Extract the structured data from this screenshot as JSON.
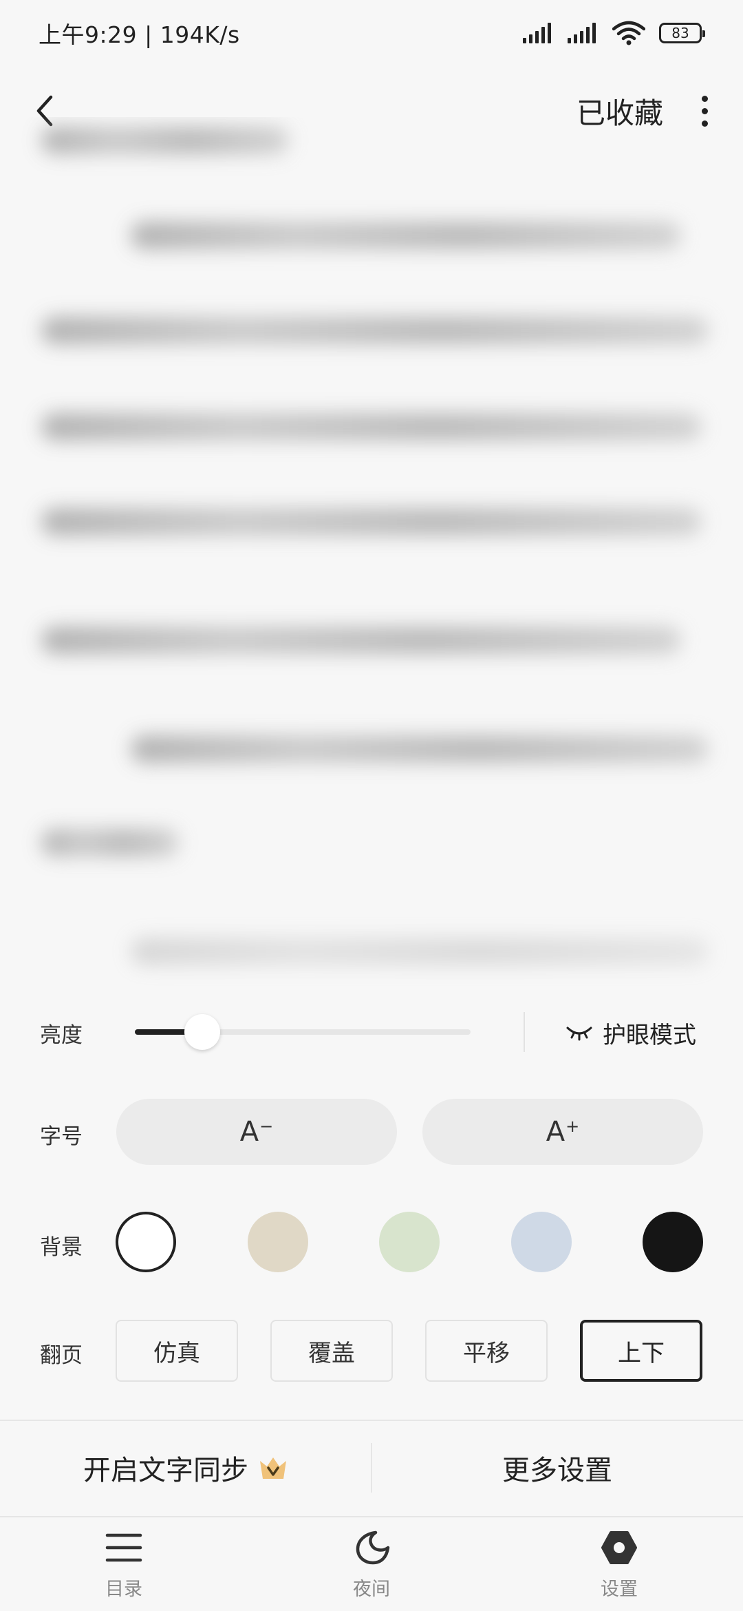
{
  "status": {
    "time_speed": "上午9:29 | 194K/s",
    "battery": "83"
  },
  "header": {
    "fav_label": "已收藏"
  },
  "settings": {
    "brightness_label": "亮度",
    "brightness_level": 0.2,
    "eye_mode_label": "护眼模式",
    "font_label": "字号",
    "font_decrease": "A",
    "font_decrease_mark": "−",
    "font_increase": "A",
    "font_increase_mark": "+",
    "background_label": "背景",
    "backgrounds": [
      "#ffffff",
      "#e0d8c6",
      "#d8e4cd",
      "#cfd9e6",
      "#151515"
    ],
    "selected_background": 0,
    "page_turn_label": "翻页",
    "page_turn_options": [
      "仿真",
      "覆盖",
      "平移",
      "上下"
    ],
    "selected_page_turn": 3
  },
  "actions": {
    "sync_label": "开启文字同步",
    "more_label": "更多设置"
  },
  "bottom_nav": {
    "items": [
      {
        "label": "目录",
        "icon": "list-icon"
      },
      {
        "label": "夜间",
        "icon": "moon-icon"
      },
      {
        "label": "设置",
        "icon": "gear-icon"
      }
    ]
  },
  "colors": {
    "accent": "#222222",
    "vip_crown": "#f0c27a"
  }
}
